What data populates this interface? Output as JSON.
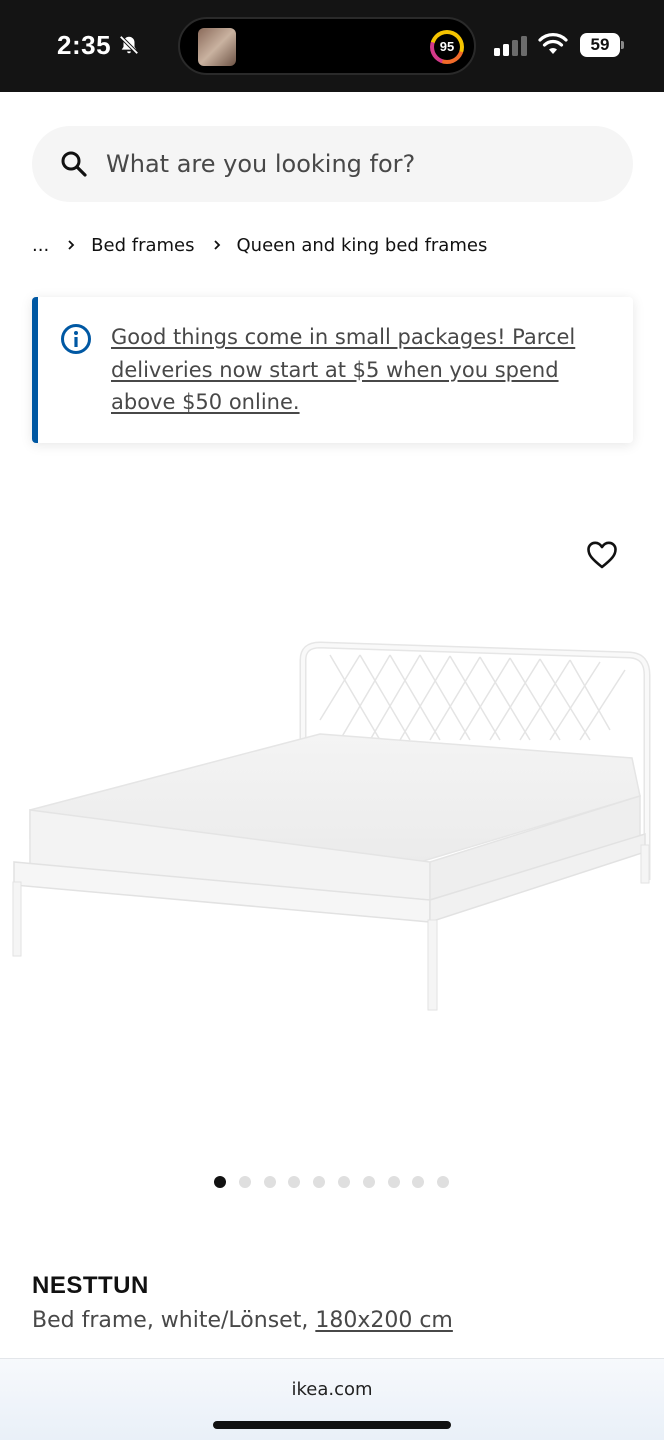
{
  "status_bar": {
    "time": "2:35",
    "activity_ring_value": "95",
    "battery": "59",
    "icons": [
      "bell-slash-icon",
      "signal-icon",
      "wifi-icon",
      "battery-icon"
    ]
  },
  "search": {
    "placeholder": "What are you looking for?",
    "icon": "search-icon"
  },
  "breadcrumb": {
    "items": [
      "...",
      "Bed frames",
      "Queen and king bed frames"
    ],
    "separator_icon": "chevron-right-icon"
  },
  "notice": {
    "icon": "info-icon",
    "text": "Good things come in small packages! Parcel deliveries now start at $5 when you spend above $50 online.",
    "accent_color": "#0058a3"
  },
  "product": {
    "wishlist_icon": "heart-icon",
    "image_alt": "bed-frame-image",
    "carousel": {
      "total": 10,
      "active_index": 0
    },
    "name": "NESTTUN",
    "description": "Bed frame, white/Lönset, ",
    "size": "180x200 cm"
  },
  "browser": {
    "url": "ikea.com"
  }
}
